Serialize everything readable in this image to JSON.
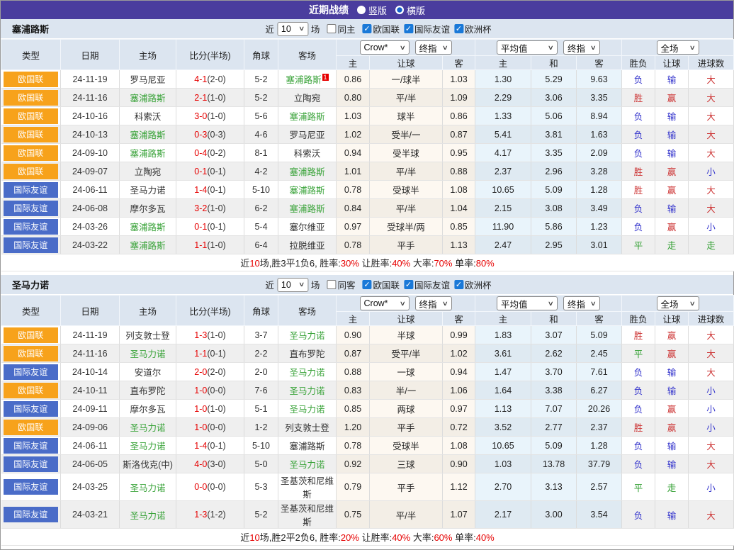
{
  "title_bar": {
    "title": "近期战绩",
    "radio_vertical": "竖版",
    "radio_horizontal": "横版"
  },
  "filters": {
    "near_label": "近",
    "count_value": "10",
    "games_label": "场",
    "league_options": [
      "欧国联",
      "国际友谊",
      "欧洲杯"
    ]
  },
  "columns": {
    "left": [
      "类型",
      "日期",
      "主场",
      "比分(半场)",
      "角球",
      "客场"
    ],
    "odds_group": {
      "select1": "Crow*",
      "select2": "终指",
      "cols": [
        "主",
        "让球",
        "客"
      ]
    },
    "avg_group": {
      "select1": "平均值",
      "select2": "终指",
      "cols": [
        "主",
        "和",
        "客"
      ]
    },
    "result_group": {
      "select": "全场",
      "cols": [
        "胜负",
        "让球",
        "进球数"
      ]
    }
  },
  "colors": {
    "accent_purple": "#4a3d9e",
    "badge_orange": "#f7a21b",
    "badge_blue": "#4a6cc8",
    "score_red": "#e60000",
    "win_red": "#cc3333",
    "lose_blue": "#3333cc",
    "draw_green": "#2f9e2f",
    "team_highlight_green": "#3aa33a"
  },
  "sections": [
    {
      "team": "塞浦路斯",
      "same_label": "同主",
      "rows": [
        {
          "league": "欧国联",
          "league_color": "orange",
          "date": "24-11-19",
          "home": "罗马尼亚",
          "home_hl": false,
          "score_ft": "4-1",
          "score_ht": "(2-0)",
          "corner": "5-2",
          "away": "塞浦路斯",
          "away_hl": true,
          "away_badge": "1",
          "odds_home": "0.86",
          "handicap": "一/球半",
          "odds_away": "1.03",
          "avg_home": "1.30",
          "avg_draw": "5.29",
          "avg_away": "9.63",
          "res_wl": "负",
          "res_wl_color": "blue",
          "res_hcap": "输",
          "res_hcap_color": "blue",
          "res_goal": "大",
          "res_goal_color": "red"
        },
        {
          "league": "欧国联",
          "league_color": "orange",
          "date": "24-11-16",
          "home": "塞浦路斯",
          "home_hl": true,
          "score_ft": "2-1",
          "score_ht": "(1-0)",
          "corner": "5-2",
          "away": "立陶宛",
          "away_hl": false,
          "away_badge": "",
          "odds_home": "0.80",
          "handicap": "平/半",
          "odds_away": "1.09",
          "avg_home": "2.29",
          "avg_draw": "3.06",
          "avg_away": "3.35",
          "res_wl": "胜",
          "res_wl_color": "red",
          "res_hcap": "赢",
          "res_hcap_color": "red",
          "res_goal": "大",
          "res_goal_color": "red"
        },
        {
          "league": "欧国联",
          "league_color": "orange",
          "date": "24-10-16",
          "home": "科索沃",
          "home_hl": false,
          "score_ft": "3-0",
          "score_ht": "(1-0)",
          "corner": "5-6",
          "away": "塞浦路斯",
          "away_hl": true,
          "away_badge": "",
          "odds_home": "1.03",
          "handicap": "球半",
          "odds_away": "0.86",
          "avg_home": "1.33",
          "avg_draw": "5.06",
          "avg_away": "8.94",
          "res_wl": "负",
          "res_wl_color": "blue",
          "res_hcap": "输",
          "res_hcap_color": "blue",
          "res_goal": "大",
          "res_goal_color": "red"
        },
        {
          "league": "欧国联",
          "league_color": "orange",
          "date": "24-10-13",
          "home": "塞浦路斯",
          "home_hl": true,
          "score_ft": "0-3",
          "score_ht": "(0-3)",
          "corner": "4-6",
          "away": "罗马尼亚",
          "away_hl": false,
          "away_badge": "",
          "odds_home": "1.02",
          "handicap": "受半/一",
          "odds_away": "0.87",
          "avg_home": "5.41",
          "avg_draw": "3.81",
          "avg_away": "1.63",
          "res_wl": "负",
          "res_wl_color": "blue",
          "res_hcap": "输",
          "res_hcap_color": "blue",
          "res_goal": "大",
          "res_goal_color": "red"
        },
        {
          "league": "欧国联",
          "league_color": "orange",
          "date": "24-09-10",
          "home": "塞浦路斯",
          "home_hl": true,
          "score_ft": "0-4",
          "score_ht": "(0-2)",
          "corner": "8-1",
          "away": "科索沃",
          "away_hl": false,
          "away_badge": "",
          "odds_home": "0.94",
          "handicap": "受半球",
          "odds_away": "0.95",
          "avg_home": "4.17",
          "avg_draw": "3.35",
          "avg_away": "2.09",
          "res_wl": "负",
          "res_wl_color": "blue",
          "res_hcap": "输",
          "res_hcap_color": "blue",
          "res_goal": "大",
          "res_goal_color": "red"
        },
        {
          "league": "欧国联",
          "league_color": "orange",
          "date": "24-09-07",
          "home": "立陶宛",
          "home_hl": false,
          "score_ft": "0-1",
          "score_ht": "(0-1)",
          "corner": "4-2",
          "away": "塞浦路斯",
          "away_hl": true,
          "away_badge": "",
          "odds_home": "1.01",
          "handicap": "平/半",
          "odds_away": "0.88",
          "avg_home": "2.37",
          "avg_draw": "2.96",
          "avg_away": "3.28",
          "res_wl": "胜",
          "res_wl_color": "red",
          "res_hcap": "赢",
          "res_hcap_color": "red",
          "res_goal": "小",
          "res_goal_color": "blue"
        },
        {
          "league": "国际友谊",
          "league_color": "blue",
          "date": "24-06-11",
          "home": "圣马力诺",
          "home_hl": false,
          "score_ft": "1-4",
          "score_ht": "(0-1)",
          "corner": "5-10",
          "away": "塞浦路斯",
          "away_hl": true,
          "away_badge": "",
          "odds_home": "0.78",
          "handicap": "受球半",
          "odds_away": "1.08",
          "avg_home": "10.65",
          "avg_draw": "5.09",
          "avg_away": "1.28",
          "res_wl": "胜",
          "res_wl_color": "red",
          "res_hcap": "赢",
          "res_hcap_color": "red",
          "res_goal": "大",
          "res_goal_color": "red"
        },
        {
          "league": "国际友谊",
          "league_color": "blue",
          "date": "24-06-08",
          "home": "摩尔多瓦",
          "home_hl": false,
          "score_ft": "3-2",
          "score_ht": "(1-0)",
          "corner": "6-2",
          "away": "塞浦路斯",
          "away_hl": true,
          "away_badge": "",
          "odds_home": "0.84",
          "handicap": "平/半",
          "odds_away": "1.04",
          "avg_home": "2.15",
          "avg_draw": "3.08",
          "avg_away": "3.49",
          "res_wl": "负",
          "res_wl_color": "blue",
          "res_hcap": "输",
          "res_hcap_color": "blue",
          "res_goal": "大",
          "res_goal_color": "red"
        },
        {
          "league": "国际友谊",
          "league_color": "blue",
          "date": "24-03-26",
          "home": "塞浦路斯",
          "home_hl": true,
          "score_ft": "0-1",
          "score_ht": "(0-1)",
          "corner": "5-4",
          "away": "塞尔维亚",
          "away_hl": false,
          "away_badge": "",
          "odds_home": "0.97",
          "handicap": "受球半/两",
          "odds_away": "0.85",
          "avg_home": "11.90",
          "avg_draw": "5.86",
          "avg_away": "1.23",
          "res_wl": "负",
          "res_wl_color": "blue",
          "res_hcap": "赢",
          "res_hcap_color": "red",
          "res_goal": "小",
          "res_goal_color": "blue"
        },
        {
          "league": "国际友谊",
          "league_color": "blue",
          "date": "24-03-22",
          "home": "塞浦路斯",
          "home_hl": true,
          "score_ft": "1-1",
          "score_ht": "(1-0)",
          "corner": "6-4",
          "away": "拉脱维亚",
          "away_hl": false,
          "away_badge": "",
          "odds_home": "0.78",
          "handicap": "平手",
          "odds_away": "1.13",
          "avg_home": "2.47",
          "avg_draw": "2.95",
          "avg_away": "3.01",
          "res_wl": "平",
          "res_wl_color": "green",
          "res_hcap": "走",
          "res_hcap_color": "green",
          "res_goal": "走",
          "res_goal_color": "green"
        }
      ],
      "summary": [
        {
          "t": "近",
          "red": false
        },
        {
          "t": "10",
          "red": true
        },
        {
          "t": "场,胜3平1负6, 胜率:",
          "red": false
        },
        {
          "t": "30%",
          "red": true
        },
        {
          "t": " 让胜率:",
          "red": false
        },
        {
          "t": "40%",
          "red": true
        },
        {
          "t": " 大率:",
          "red": false
        },
        {
          "t": "70%",
          "red": true
        },
        {
          "t": " 单率:",
          "red": false
        },
        {
          "t": "80%",
          "red": true
        }
      ]
    },
    {
      "team": "圣马力诺",
      "same_label": "同客",
      "rows": [
        {
          "league": "欧国联",
          "league_color": "orange",
          "date": "24-11-19",
          "home": "列支敦士登",
          "home_hl": false,
          "score_ft": "1-3",
          "score_ht": "(1-0)",
          "corner": "3-7",
          "away": "圣马力诺",
          "away_hl": true,
          "away_badge": "",
          "odds_home": "0.90",
          "handicap": "半球",
          "odds_away": "0.99",
          "avg_home": "1.83",
          "avg_draw": "3.07",
          "avg_away": "5.09",
          "res_wl": "胜",
          "res_wl_color": "red",
          "res_hcap": "赢",
          "res_hcap_color": "red",
          "res_goal": "大",
          "res_goal_color": "red"
        },
        {
          "league": "欧国联",
          "league_color": "orange",
          "date": "24-11-16",
          "home": "圣马力诺",
          "home_hl": true,
          "score_ft": "1-1",
          "score_ht": "(0-1)",
          "corner": "2-2",
          "away": "直布罗陀",
          "away_hl": false,
          "away_badge": "",
          "odds_home": "0.87",
          "handicap": "受平/半",
          "odds_away": "1.02",
          "avg_home": "3.61",
          "avg_draw": "2.62",
          "avg_away": "2.45",
          "res_wl": "平",
          "res_wl_color": "green",
          "res_hcap": "赢",
          "res_hcap_color": "red",
          "res_goal": "大",
          "res_goal_color": "red"
        },
        {
          "league": "国际友谊",
          "league_color": "blue",
          "date": "24-10-14",
          "home": "安道尔",
          "home_hl": false,
          "score_ft": "2-0",
          "score_ht": "(2-0)",
          "corner": "2-0",
          "away": "圣马力诺",
          "away_hl": true,
          "away_badge": "",
          "odds_home": "0.88",
          "handicap": "一球",
          "odds_away": "0.94",
          "avg_home": "1.47",
          "avg_draw": "3.70",
          "avg_away": "7.61",
          "res_wl": "负",
          "res_wl_color": "blue",
          "res_hcap": "输",
          "res_hcap_color": "blue",
          "res_goal": "大",
          "res_goal_color": "red"
        },
        {
          "league": "欧国联",
          "league_color": "orange",
          "date": "24-10-11",
          "home": "直布罗陀",
          "home_hl": false,
          "score_ft": "1-0",
          "score_ht": "(0-0)",
          "corner": "7-6",
          "away": "圣马力诺",
          "away_hl": true,
          "away_badge": "",
          "odds_home": "0.83",
          "handicap": "半/一",
          "odds_away": "1.06",
          "avg_home": "1.64",
          "avg_draw": "3.38",
          "avg_away": "6.27",
          "res_wl": "负",
          "res_wl_color": "blue",
          "res_hcap": "输",
          "res_hcap_color": "blue",
          "res_goal": "小",
          "res_goal_color": "blue"
        },
        {
          "league": "国际友谊",
          "league_color": "blue",
          "date": "24-09-11",
          "home": "摩尔多瓦",
          "home_hl": false,
          "score_ft": "1-0",
          "score_ht": "(1-0)",
          "corner": "5-1",
          "away": "圣马力诺",
          "away_hl": true,
          "away_badge": "",
          "odds_home": "0.85",
          "handicap": "两球",
          "odds_away": "0.97",
          "avg_home": "1.13",
          "avg_draw": "7.07",
          "avg_away": "20.26",
          "res_wl": "负",
          "res_wl_color": "blue",
          "res_hcap": "赢",
          "res_hcap_color": "red",
          "res_goal": "小",
          "res_goal_color": "blue"
        },
        {
          "league": "欧国联",
          "league_color": "orange",
          "date": "24-09-06",
          "home": "圣马力诺",
          "home_hl": true,
          "score_ft": "1-0",
          "score_ht": "(0-0)",
          "corner": "1-2",
          "away": "列支敦士登",
          "away_hl": false,
          "away_badge": "",
          "odds_home": "1.20",
          "handicap": "平手",
          "odds_away": "0.72",
          "avg_home": "3.52",
          "avg_draw": "2.77",
          "avg_away": "2.37",
          "res_wl": "胜",
          "res_wl_color": "red",
          "res_hcap": "赢",
          "res_hcap_color": "red",
          "res_goal": "小",
          "res_goal_color": "blue"
        },
        {
          "league": "国际友谊",
          "league_color": "blue",
          "date": "24-06-11",
          "home": "圣马力诺",
          "home_hl": true,
          "score_ft": "1-4",
          "score_ht": "(0-1)",
          "corner": "5-10",
          "away": "塞浦路斯",
          "away_hl": false,
          "away_badge": "",
          "odds_home": "0.78",
          "handicap": "受球半",
          "odds_away": "1.08",
          "avg_home": "10.65",
          "avg_draw": "5.09",
          "avg_away": "1.28",
          "res_wl": "负",
          "res_wl_color": "blue",
          "res_hcap": "输",
          "res_hcap_color": "blue",
          "res_goal": "大",
          "res_goal_color": "red"
        },
        {
          "league": "国际友谊",
          "league_color": "blue",
          "date": "24-06-05",
          "home": "斯洛伐克(中)",
          "home_hl": false,
          "score_ft": "4-0",
          "score_ht": "(3-0)",
          "corner": "5-0",
          "away": "圣马力诺",
          "away_hl": true,
          "away_badge": "",
          "odds_home": "0.92",
          "handicap": "三球",
          "odds_away": "0.90",
          "avg_home": "1.03",
          "avg_draw": "13.78",
          "avg_away": "37.79",
          "res_wl": "负",
          "res_wl_color": "blue",
          "res_hcap": "输",
          "res_hcap_color": "blue",
          "res_goal": "大",
          "res_goal_color": "red"
        },
        {
          "league": "国际友谊",
          "league_color": "blue",
          "date": "24-03-25",
          "home": "圣马力诺",
          "home_hl": true,
          "score_ft": "0-0",
          "score_ht": "(0-0)",
          "corner": "5-3",
          "away": "圣基茨和尼维斯",
          "away_hl": false,
          "away_badge": "",
          "odds_home": "0.79",
          "handicap": "平手",
          "odds_away": "1.12",
          "avg_home": "2.70",
          "avg_draw": "3.13",
          "avg_away": "2.57",
          "res_wl": "平",
          "res_wl_color": "green",
          "res_hcap": "走",
          "res_hcap_color": "green",
          "res_goal": "小",
          "res_goal_color": "blue"
        },
        {
          "league": "国际友谊",
          "league_color": "blue",
          "date": "24-03-21",
          "home": "圣马力诺",
          "home_hl": true,
          "score_ft": "1-3",
          "score_ht": "(1-2)",
          "corner": "5-2",
          "away": "圣基茨和尼维斯",
          "away_hl": false,
          "away_badge": "",
          "odds_home": "0.75",
          "handicap": "平/半",
          "odds_away": "1.07",
          "avg_home": "2.17",
          "avg_draw": "3.00",
          "avg_away": "3.54",
          "res_wl": "负",
          "res_wl_color": "blue",
          "res_hcap": "输",
          "res_hcap_color": "blue",
          "res_goal": "大",
          "res_goal_color": "red"
        }
      ],
      "summary": [
        {
          "t": "近",
          "red": false
        },
        {
          "t": "10",
          "red": true
        },
        {
          "t": "场,胜2平2负6, 胜率:",
          "red": false
        },
        {
          "t": "20%",
          "red": true
        },
        {
          "t": " 让胜率:",
          "red": false
        },
        {
          "t": "40%",
          "red": true
        },
        {
          "t": " 大率:",
          "red": false
        },
        {
          "t": "60%",
          "red": true
        },
        {
          "t": " 单率:",
          "red": false
        },
        {
          "t": "40%",
          "red": true
        }
      ]
    }
  ]
}
